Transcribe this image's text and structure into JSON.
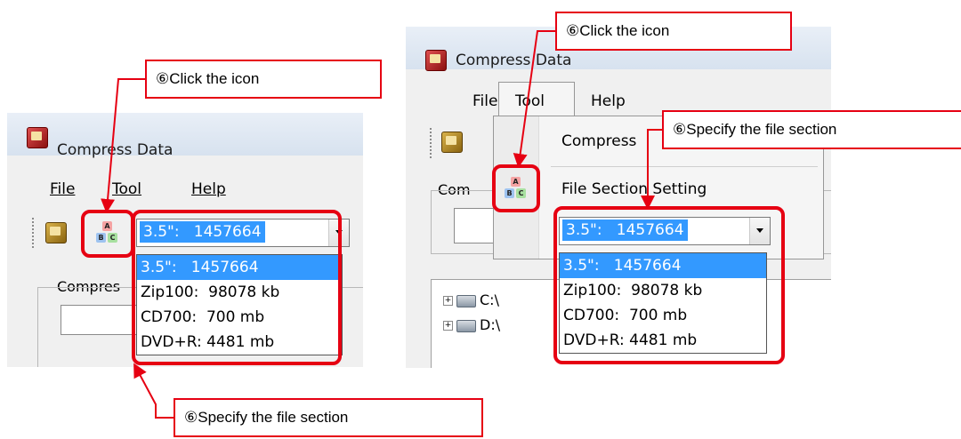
{
  "left_window": {
    "title": "Compress Data",
    "menu": {
      "file": "File",
      "tool": "Tool",
      "help": "Help"
    },
    "combo_value": "3.5\":   1457664",
    "group_label": "Compres"
  },
  "right_window": {
    "title": "Compress Data",
    "menu": {
      "file": "File",
      "tool": "Tool",
      "help": "Help"
    },
    "tool_menu": {
      "compress": "Compress",
      "file_section_setting": "File Section Setting"
    },
    "combo_value": "3.5\":   1457664",
    "group_label": "Com",
    "tree": [
      {
        "label": "C:\\"
      },
      {
        "label": "D:\\"
      }
    ]
  },
  "dropdown_options": [
    "3.5\":   1457664",
    "Zip100:  98078 kb",
    "CD700:  700 mb",
    "DVD+R: 4481 mb"
  ],
  "callouts": {
    "left_click_icon": "⑥Click the icon",
    "left_specify": "⑥Specify the file section",
    "right_click_icon": "⑥Click the icon",
    "right_specify": "⑥Specify the file section"
  },
  "colors": {
    "highlight": "#e60012",
    "selection": "#3399ff"
  }
}
